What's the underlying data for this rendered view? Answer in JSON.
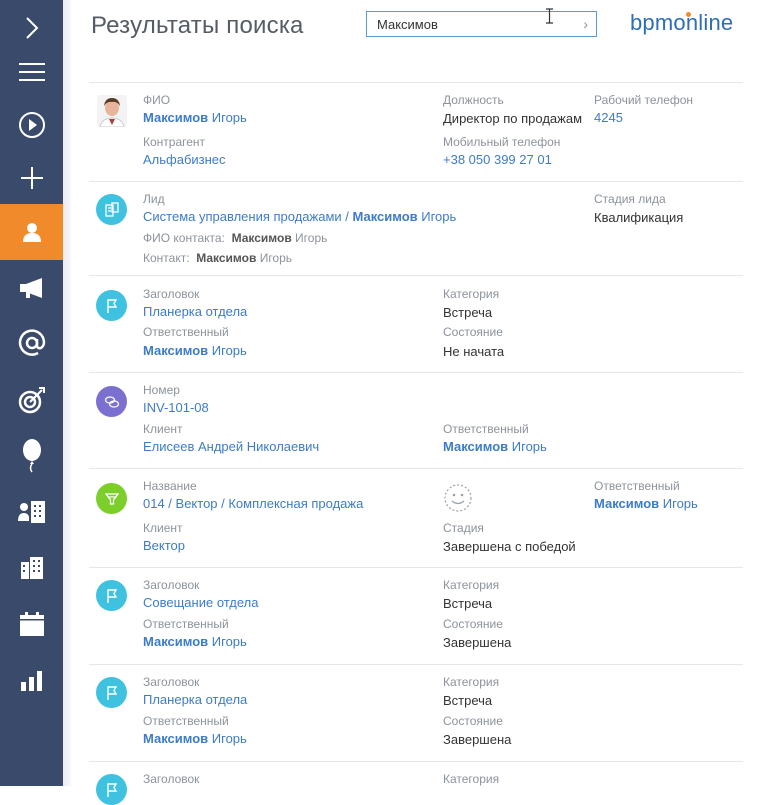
{
  "header": {
    "title": "Результаты поиска",
    "search_value": "Максимов",
    "logo": "bpmonline"
  },
  "sidebar": {
    "items": [
      {
        "icon": "chevron-right-icon"
      },
      {
        "icon": "menu-icon"
      },
      {
        "icon": "play-icon"
      },
      {
        "icon": "plus-icon"
      },
      {
        "icon": "contact-icon",
        "active": true
      },
      {
        "icon": "megaphone-icon"
      },
      {
        "icon": "at-icon"
      },
      {
        "icon": "target-icon"
      },
      {
        "icon": "balloon-icon"
      },
      {
        "icon": "accounts-icon"
      },
      {
        "icon": "building-icon"
      },
      {
        "icon": "calendar-icon"
      },
      {
        "icon": "chart-icon"
      }
    ]
  },
  "results": {
    "r1": {
      "fio_label": "ФИО",
      "fio_first": "Максимов",
      "fio_rest": " Игорь",
      "pos_label": "Должность",
      "pos_value": "Директор по продажам",
      "phone_label": "Рабочий телефон",
      "phone_value": "4245",
      "acc_label": "Контрагент",
      "acc_value": "Альфабизнес",
      "mob_label": "Мобильный телефон",
      "mob_value": "+38 050 399 27 01"
    },
    "r2": {
      "lead_label": "Лид",
      "lead_prefix": "Система управления продажами / ",
      "lead_hl": "Максимов",
      "lead_rest": " Игорь",
      "stage_label": "Стадия лида",
      "stage_value": "Квалификация",
      "fio_contact_label": "ФИО контакта:",
      "fio_contact_hl": "Максимов",
      "fio_contact_rest": " Игорь",
      "contact_label": "Контакт:",
      "contact_hl": "Максимов",
      "contact_rest": " Игорь"
    },
    "r3": {
      "title_label": "Заголовок",
      "title_value": "Планерка отдела",
      "cat_label": "Категория",
      "cat_value": "Встреча",
      "resp_label": "Ответственный",
      "resp_hl": "Максимов",
      "resp_rest": " Игорь",
      "state_label": "Состояние",
      "state_value": "Не начата"
    },
    "r4": {
      "num_label": "Номер",
      "num_value": "INV-101-08",
      "client_label": "Клиент",
      "client_value": "Елисеев Андрей Николаевич",
      "resp_label": "Ответственный",
      "resp_hl": "Максимов",
      "resp_rest": " Игорь"
    },
    "r5": {
      "name_label": "Название",
      "name_value": "014 / Вектор / Комплексная продажа",
      "resp_label": "Ответственный",
      "resp_hl": "Максимов",
      "resp_rest": " Игорь",
      "client_label": "Клиент",
      "client_value": "Вектор",
      "stage_label": "Стадия",
      "stage_value": "Завершена с победой"
    },
    "r6": {
      "title_label": "Заголовок",
      "title_value": "Совещание отдела",
      "cat_label": "Категория",
      "cat_value": "Встреча",
      "resp_label": "Ответственный",
      "resp_hl": "Максимов",
      "resp_rest": " Игорь",
      "state_label": "Состояние",
      "state_value": "Завершена"
    },
    "r7": {
      "title_label": "Заголовок",
      "title_value": "Планерка отдела",
      "cat_label": "Категория",
      "cat_value": "Встреча",
      "resp_label": "Ответственный",
      "resp_hl": "Максимов",
      "resp_rest": " Игорь",
      "state_label": "Состояние",
      "state_value": "Завершена"
    },
    "r8": {
      "title_label": "Заголовок",
      "cat_label": "Категория"
    }
  },
  "colors": {
    "sidebar": "#3a4a6b",
    "active": "#f08a2a",
    "link": "#3d7cc9",
    "badge_blue": "#3fc1e0",
    "badge_purple": "#7b6fd0",
    "badge_green": "#7ccf2a"
  }
}
